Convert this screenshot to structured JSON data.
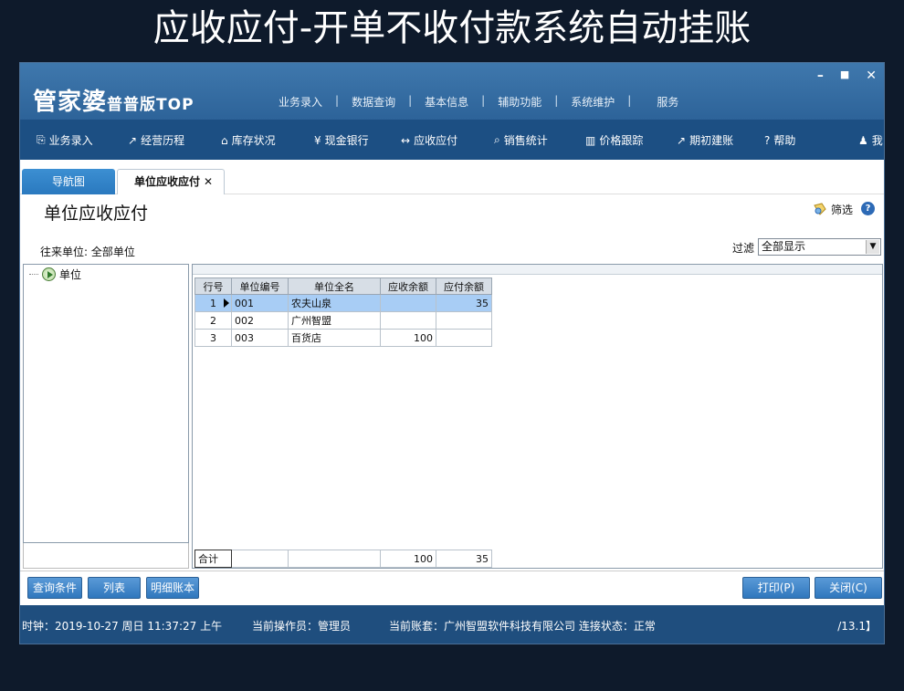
{
  "headline": "应收应付-开单不收付款系统自动挂账",
  "app": {
    "logo_main": "管家婆",
    "logo_sub": "普普版TOP",
    "topmenu": [
      "业务录入",
      "数据查询",
      "基本信息",
      "辅助功能",
      "系统维护",
      "服务"
    ],
    "window_controls": [
      "–",
      "■",
      "✕"
    ]
  },
  "toolbar": [
    {
      "icon": "document-icon",
      "glyph": "⎘",
      "label": "业务录入"
    },
    {
      "icon": "chart-icon",
      "glyph": "↗",
      "label": "经营历程"
    },
    {
      "icon": "home-icon",
      "glyph": "⌂",
      "label": "库存状况"
    },
    {
      "icon": "yen-icon",
      "glyph": "¥",
      "label": "现金银行"
    },
    {
      "icon": "exchange-icon",
      "glyph": "↔",
      "label": "应收应付"
    },
    {
      "icon": "search-icon",
      "glyph": "⌕",
      "label": "销售统计"
    },
    {
      "icon": "bar-chart-icon",
      "glyph": "▥",
      "label": "价格跟踪"
    },
    {
      "icon": "export-icon",
      "glyph": "↗",
      "label": "期初建账"
    },
    {
      "icon": "question-icon",
      "glyph": "?",
      "label": "帮助"
    },
    {
      "icon": "user-icon",
      "glyph": "♟",
      "label": "我"
    }
  ],
  "tabs": {
    "nav": "导航图",
    "active": "单位应收应付",
    "close": "✕"
  },
  "page": {
    "title": "单位应收应付",
    "filter_button": "筛选",
    "help": "?",
    "unit_label": "往来单位: 全部单位",
    "filter_label": "过滤",
    "filter_value": "全部显示"
  },
  "tree": {
    "root": "单位"
  },
  "grid": {
    "columns": [
      "行号",
      "单位编号",
      "单位全名",
      "应收余额",
      "应付余额"
    ],
    "rows": [
      [
        "1",
        "001",
        "农夫山泉",
        "",
        "35"
      ],
      [
        "2",
        "002",
        "广州智盟",
        "",
        ""
      ],
      [
        "3",
        "003",
        "百货店",
        "100",
        ""
      ]
    ],
    "total": [
      "合计",
      "",
      "",
      "100",
      "35"
    ]
  },
  "buttons": {
    "query": "查询条件",
    "list": "列表",
    "detail": "明细账本",
    "print": "打印(P)",
    "close": "关闭(C)"
  },
  "status": {
    "clock": "时钟：2019-10-27 周日 11:37:27 上午",
    "operator": "当前操作员：管理员",
    "account": "当前账套：广州智盟软件科技有限公司 连接状态：正常",
    "version": "/13.1】"
  }
}
